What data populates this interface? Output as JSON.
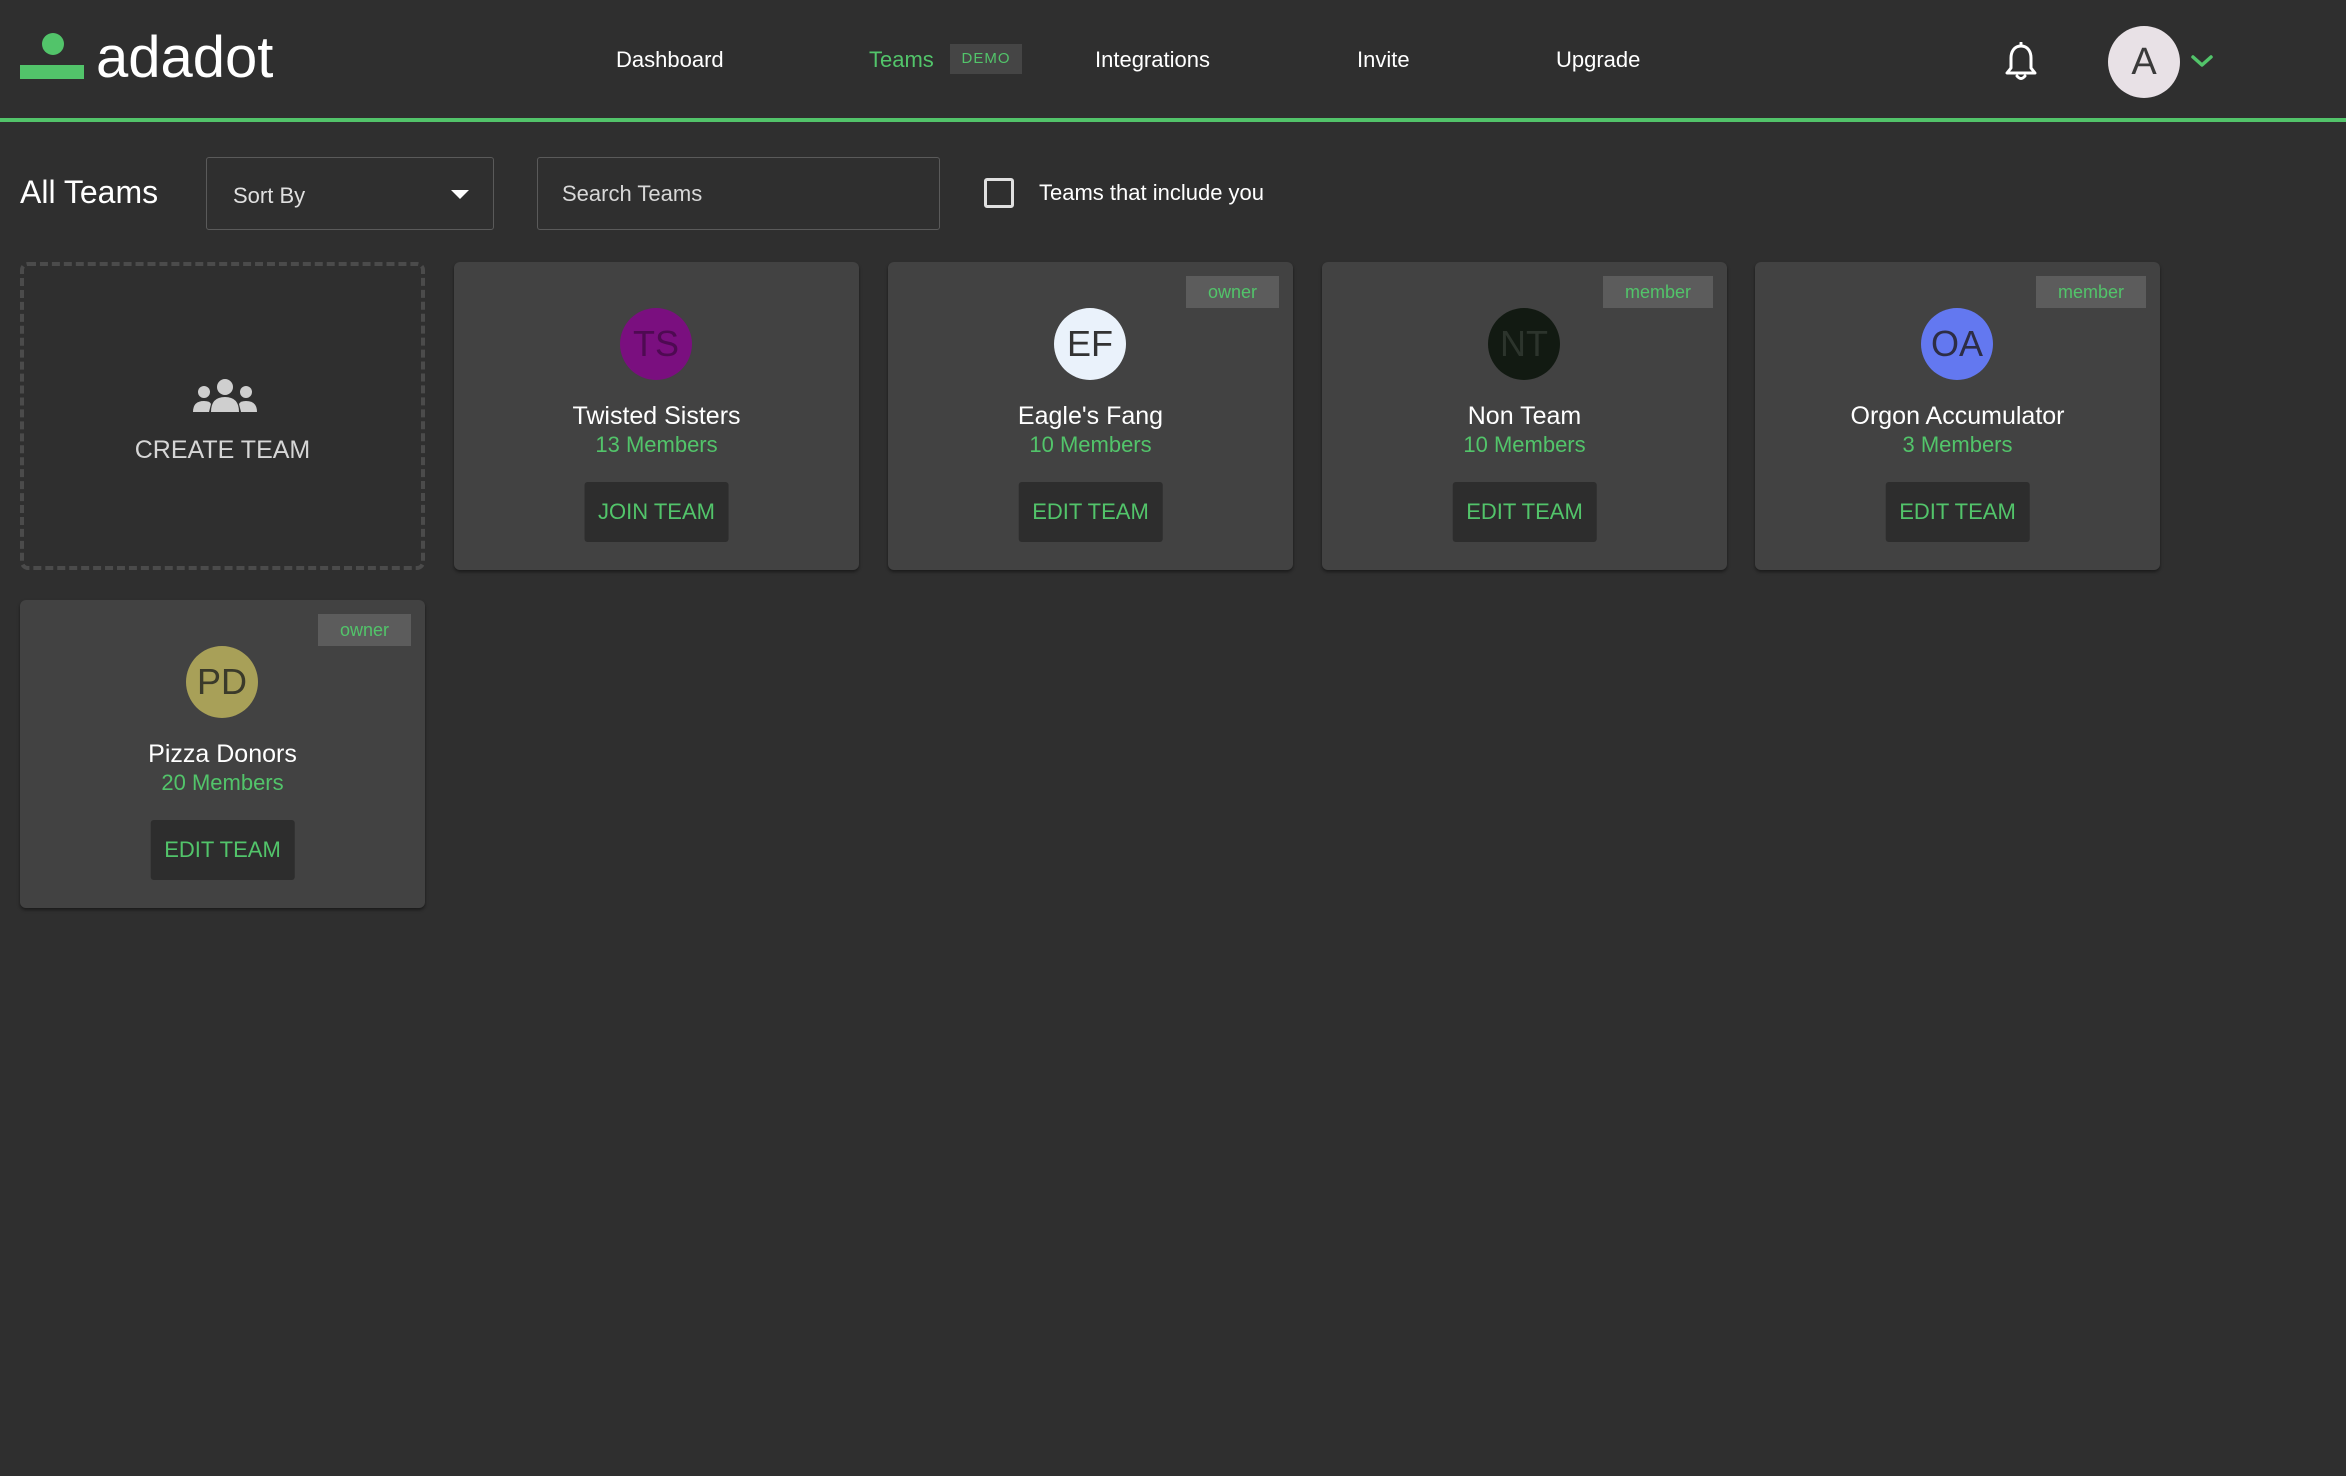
{
  "app": {
    "logo_text": "adadot"
  },
  "nav": {
    "dashboard": "Dashboard",
    "teams": "Teams",
    "demo_badge": "DEMO",
    "integrations": "Integrations",
    "invite": "Invite",
    "upgrade": "Upgrade"
  },
  "user": {
    "initial": "A"
  },
  "toolbar": {
    "title": "All Teams",
    "sort_label": "Sort By",
    "search_placeholder": "Search Teams",
    "filter_label": "Teams that include you"
  },
  "create": {
    "label": "CREATE TEAM"
  },
  "colors": {
    "accent": "#52c46a",
    "background": "#2f2f2f",
    "card": "#424242"
  },
  "teams": [
    {
      "initials": "TS",
      "name": "Twisted Sisters",
      "members": "13 Members",
      "role": "",
      "action": "JOIN TEAM",
      "avatar_bg": "#7a0f7f",
      "avatar_fg": "#4e0a52"
    },
    {
      "initials": "EF",
      "name": "Eagle's Fang",
      "members": "10 Members",
      "role": "owner",
      "action": "EDIT TEAM",
      "avatar_bg": "#eaf2fb",
      "avatar_fg": "#333333"
    },
    {
      "initials": "NT",
      "name": "Non Team",
      "members": "10 Members",
      "role": "member",
      "action": "EDIT TEAM",
      "avatar_bg": "#121a12",
      "avatar_fg": "#2c342c"
    },
    {
      "initials": "OA",
      "name": "Orgon Accumulator",
      "members": "3 Members",
      "role": "member",
      "action": "EDIT TEAM",
      "avatar_bg": "#6378f0",
      "avatar_fg": "#2d2d45"
    },
    {
      "initials": "PD",
      "name": "Pizza Donors",
      "members": "20 Members",
      "role": "owner",
      "action": "EDIT TEAM",
      "avatar_bg": "#a8a058",
      "avatar_fg": "#3a3a2a"
    }
  ]
}
